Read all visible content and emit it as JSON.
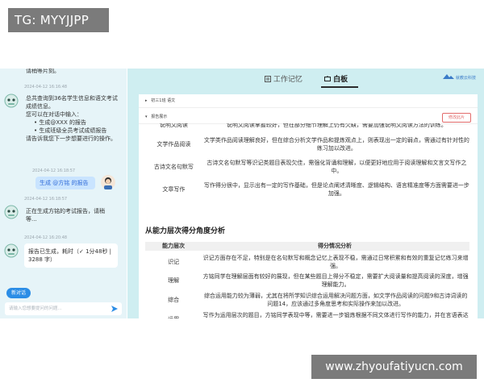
{
  "watermarks": {
    "top": "TG: MYYJJPP",
    "bottom": "www.zhyoufatiyucn.com"
  },
  "chat": {
    "partial_top_text": "请稍等片刻。",
    "time1": "2024-04-12 16:16:48",
    "bot_intro": [
      "总共查询到36名学生信息和语文考试成绩信息。",
      "您可以在对话中输入：",
      "生成@XXX 的报告",
      "生成班级全员考试成绩报告",
      "请告诉我您下一步想要进行的操作。"
    ],
    "time2": "2024-04-12 16:18:57",
    "user_msg": "生成 @方铭 的报告",
    "time3": "2024-04-12 16:18:57",
    "bot_generating": "正在生成方铭的考试报告，请稍等...",
    "time4": "2024-04-12 16:20:48",
    "report_done": "报告已生成，耗时（✓ 1分48秒 | 3288 字）",
    "new_chat_label": "新对话",
    "input_placeholder": "请输入您想要提问的问题..."
  },
  "board": {
    "tabs": [
      {
        "label": "工作记忆"
      },
      {
        "label": "白板"
      }
    ],
    "brand": "就教云科技",
    "accordion": [
      {
        "label": "初三1班 语文"
      },
      {
        "label": "报告展示"
      }
    ],
    "edit_button": "修改此片",
    "upper_rows": [
      {
        "name": "说明文阅读",
        "desc": "说明文阅读掌握较好，但在部分细节理解上仍有欠缺，需要加强说明文阅读方法的训练。"
      },
      {
        "name": "文学作品阅读",
        "desc": "文学类作品阅读理解良好，但在综合分析文学作品和提炼观点上，则表现出一定的弱点，需通过有针对性的练习加以改进。"
      },
      {
        "name": "古诗文名句默写",
        "desc": "古诗文名句默写等识记类题目表现欠佳，需强化背诵和理解，以便更好地应用于阅读理解和文言文写作之中。"
      },
      {
        "name": "文章写作",
        "desc": "写作得分很中，显示出有一定的写作基础，但是论点阐述清晰度、逻辑结构、语言精准度等方面需要进一步加强。"
      }
    ],
    "section_title": "从能力层次得分角度分析",
    "table_headers": [
      "能力层次",
      "得分情况分析"
    ],
    "ability_rows": [
      {
        "name": "识记",
        "desc": "识记方面存在不足，特别是在名句默写和概念记忆上表现不稳，需通过日常积累和有效的重复记忆练习来增强。"
      },
      {
        "name": "理解",
        "desc": "方铭同学在理解层面有较好的展现，但在某些题目上得分不稳定，需要扩大阅读量和提高阅读的深度，增强理解能力。"
      },
      {
        "name": "综合",
        "desc": "综合运用能力较为薄弱，尤其在将所学知识综合运用解决问题方面，如文学作品阅读的问题9和古诗词读的问题14，应该通过多角度思考和实际操作来加以改进。"
      },
      {
        "name": "运用",
        "desc": "写作为运用层次的题目，方铭同学表现中等，需要进一步锻炼根据不同文体进行写作的能力，并在言语表达和文章结构上做进一步提升。"
      }
    ]
  },
  "colors": {
    "accent": "#2b8de6",
    "chat_bg": "#e6f4f8",
    "board_bg": "#cfeef1",
    "danger": "#e26b6b"
  }
}
